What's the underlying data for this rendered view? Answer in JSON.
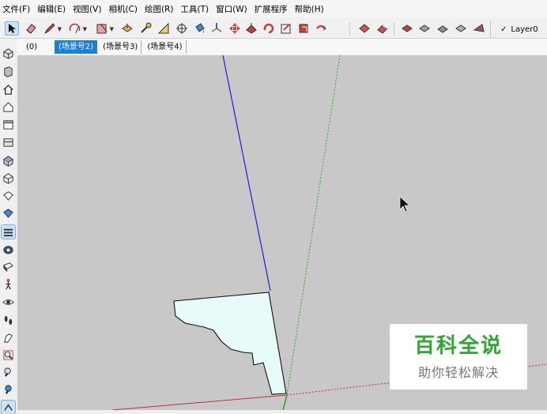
{
  "menu": {
    "items": [
      "文件(F)",
      "编辑(E)",
      "视图(V)",
      "相机(C)",
      "绘图(R)",
      "工具(T)",
      "窗口(W)",
      "扩展程序",
      "帮助(H)"
    ]
  },
  "layers": {
    "current": "Layer0"
  },
  "scenes": {
    "tabs": [
      "(0)",
      "(场景号2)",
      "(场景号3)",
      "(场景号4)"
    ],
    "active_index": 1
  },
  "watermark": {
    "title": "百科全说",
    "subtitle": "助你轻松解决"
  },
  "colors": {
    "viewport_bg": "#c8c8c8",
    "axis_blue": "#1b23d6",
    "axis_green": "#2fa82f",
    "axis_red": "#c83030",
    "profile_fill": "#e8fbfb",
    "accent": "#1a7fd9"
  }
}
